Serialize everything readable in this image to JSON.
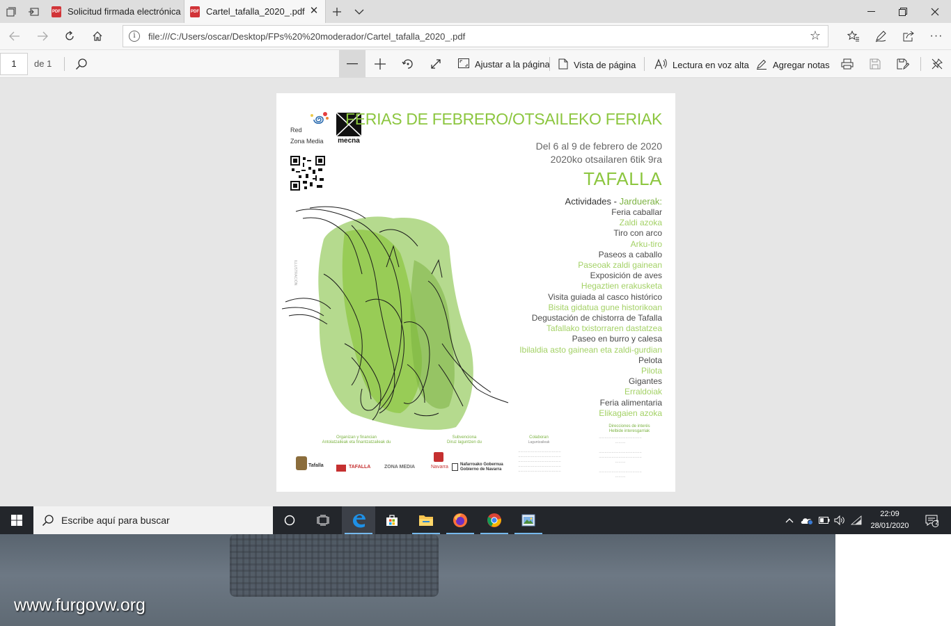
{
  "browser": {
    "tabs": [
      {
        "title": "Solicitud firmada electrónica",
        "active": false
      },
      {
        "title": "Cartel_tafalla_2020_.pdf",
        "active": true
      }
    ],
    "url": "file:///C:/Users/oscar/Desktop/FPs%20%20moderador/Cartel_tafalla_2020_.pdf"
  },
  "pdf_toolbar": {
    "page_number": "1",
    "page_of": "de 1",
    "fit_page": "Ajustar a la página",
    "page_view": "Vista de página",
    "read_aloud": "Lectura en voz alta",
    "add_notes": "Agregar notas"
  },
  "poster": {
    "title": "FERIAS DE FEBRERO/OTSAILEKO FERIAK",
    "date_es": "Del 6 al 9 de febrero de 2020",
    "date_eu": "2020ko otsailaren 6tik 9ra",
    "city": "TAFALLA",
    "activities_es": "Actividades - ",
    "activities_eu": "Jarduerak:",
    "activities": [
      {
        "text": "Feria caballar",
        "lang": "es"
      },
      {
        "text": "Zaldi azoka",
        "lang": "eu"
      },
      {
        "text": "Tiro con arco",
        "lang": "es"
      },
      {
        "text": "Arku-tiro",
        "lang": "eu"
      },
      {
        "text": "Paseos a caballo",
        "lang": "es"
      },
      {
        "text": "Paseoak zaldi gainean",
        "lang": "eu"
      },
      {
        "text": "Exposición de aves",
        "lang": "es"
      },
      {
        "text": "Hegaztien erakusketa",
        "lang": "eu"
      },
      {
        "text": "Visita guiada al casco histórico",
        "lang": "es"
      },
      {
        "text": "Bisita gidatua gune historikoan",
        "lang": "eu"
      },
      {
        "text": "Degustación de chistorra de Tafalla",
        "lang": "es"
      },
      {
        "text": "Tafallako txistorraren dastatzea",
        "lang": "eu"
      },
      {
        "text": "Paseo en burro y calesa",
        "lang": "es"
      },
      {
        "text": "Ibilaldia asto gainean eta zaldi-gurdian",
        "lang": "eu"
      },
      {
        "text": "Pelota",
        "lang": "es"
      },
      {
        "text": "Pilota",
        "lang": "eu"
      },
      {
        "text": "Gigantes",
        "lang": "es"
      },
      {
        "text": "Erraldoiak",
        "lang": "eu"
      },
      {
        "text": "Feria alimentaria",
        "lang": "es"
      },
      {
        "text": "Elikagaien azoka",
        "lang": "eu"
      }
    ],
    "logo_red_1": "Red",
    "logo_red_2": "Zona Media",
    "logo_mecna": "mecna",
    "footer": {
      "org_es": "Organizan y financian",
      "org_eu": "Antolatzaileak eta finantzatzaileak du",
      "sub_es": "Subvenciona",
      "sub_eu": "Diruz laguntzen du",
      "col_es": "Colaboran",
      "col_eu": "Laguntzaileak",
      "dir_es": "Direcciones de interés",
      "dir_eu": "Helbide interesgarriak",
      "logo_tafalla": "Tafalla",
      "logo_tafalla2": "TAFALLA",
      "logo_zona": "ZONA MEDIA",
      "logo_navarra": "Navarra",
      "logo_gobierno_eu": "Nafarroako Gobernua",
      "logo_gobierno_es": "Gobierno de Navarra"
    }
  },
  "taskbar": {
    "search_placeholder": "Escribe aquí para buscar",
    "time": "22:09",
    "date": "28/01/2020",
    "notifications": "2"
  },
  "watermark": "www.furgovw.org",
  "colors": {
    "poster_green": "#8cc63f",
    "taskbar": "#23262b",
    "edge_blue": "#0078d7"
  }
}
